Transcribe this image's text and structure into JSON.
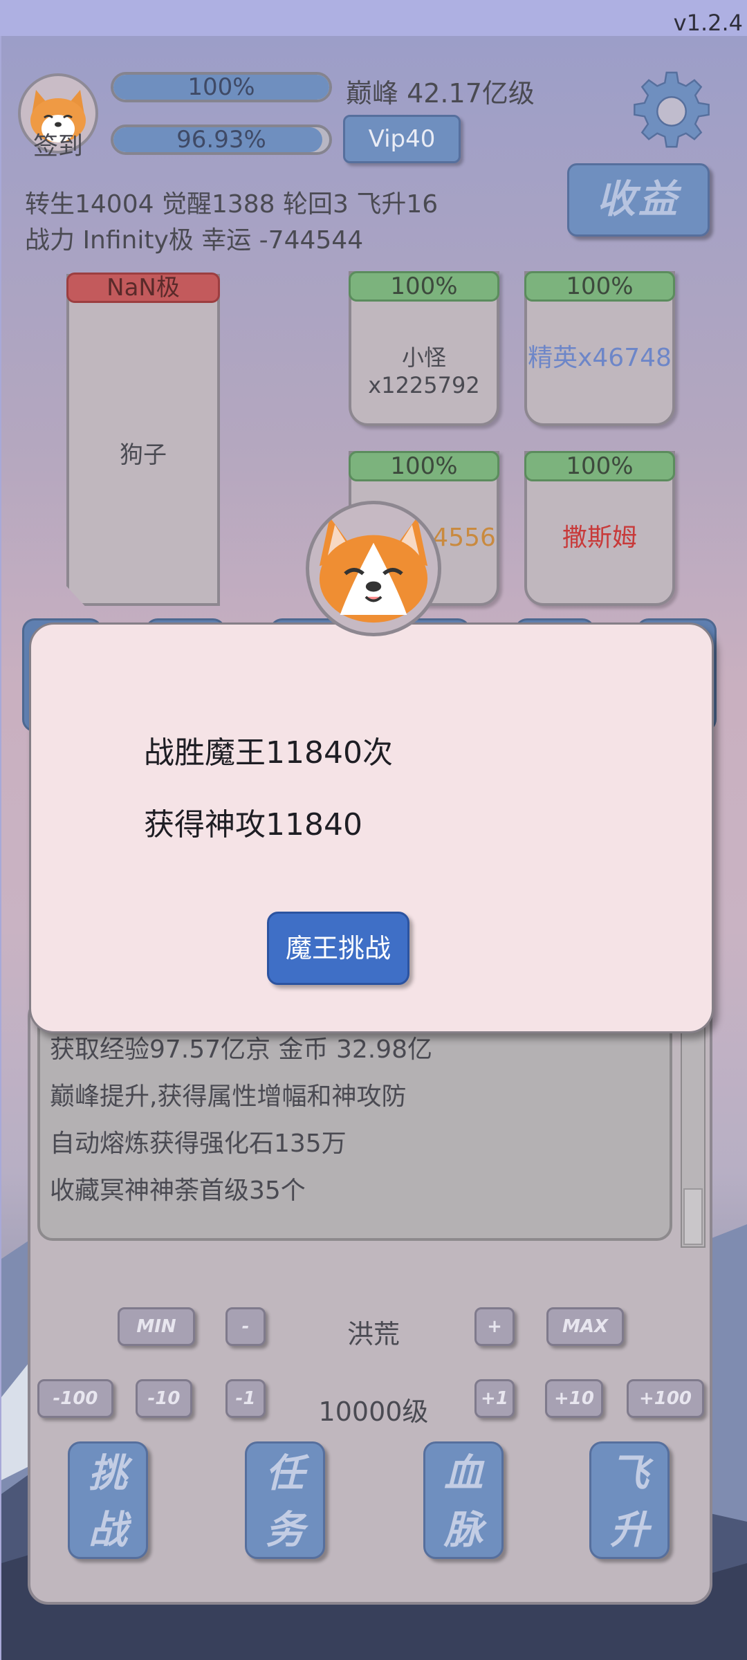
{
  "version": "v1.2.4",
  "header": {
    "signin_label": "签到",
    "progress1": {
      "text": "100%",
      "value": 1.0
    },
    "progress2": {
      "text": "96.93%",
      "value": 0.9693
    },
    "rank": "巅峰 42.17亿级",
    "vip": "Vip40",
    "income_button": "收益",
    "stats_line1": "转生14004 觉醒1388 轮回3 飞升16",
    "stats_line2": "战力 Infinity极  幸运 -744544"
  },
  "cards": {
    "dog": {
      "level": "NaN极",
      "name": "狗子"
    },
    "minion": {
      "progress": "100%",
      "label": "小怪x1225792",
      "color": "#4a4a52"
    },
    "elite": {
      "progress": "100%",
      "label": "精英x46748",
      "color": "#6d86c8"
    },
    "boss": {
      "progress": "100%",
      "label": "首领x14556",
      "color": "#c98a3f"
    },
    "sasim": {
      "progress": "100%",
      "label": "撒斯姆",
      "color": "#c83a3a"
    }
  },
  "log": {
    "lines": [
      "获取经验97.57亿京 金币 32.98亿",
      "巅峰提升,获得属性增幅和神攻防",
      "自动熔炼获得强化石135万",
      "收藏冥神神荼首级35个"
    ]
  },
  "controls": {
    "min": "MIN",
    "minus": "-",
    "difficulty": "洪荒",
    "plus": "+",
    "max": "MAX",
    "m100": "-100",
    "m10": "-10",
    "m1": "-1",
    "level": "10000级",
    "p1": "+1",
    "p10": "+10",
    "p100": "+100"
  },
  "bottom_buttons": {
    "challenge": [
      "挑",
      "战"
    ],
    "task": [
      "任",
      "务"
    ],
    "bloodline": [
      "血",
      "脉"
    ],
    "ascend": [
      "飞",
      "升"
    ]
  },
  "dialog": {
    "line1": "战胜魔王11840次",
    "line2": "获得神攻11840",
    "button": "魔王挑战"
  }
}
